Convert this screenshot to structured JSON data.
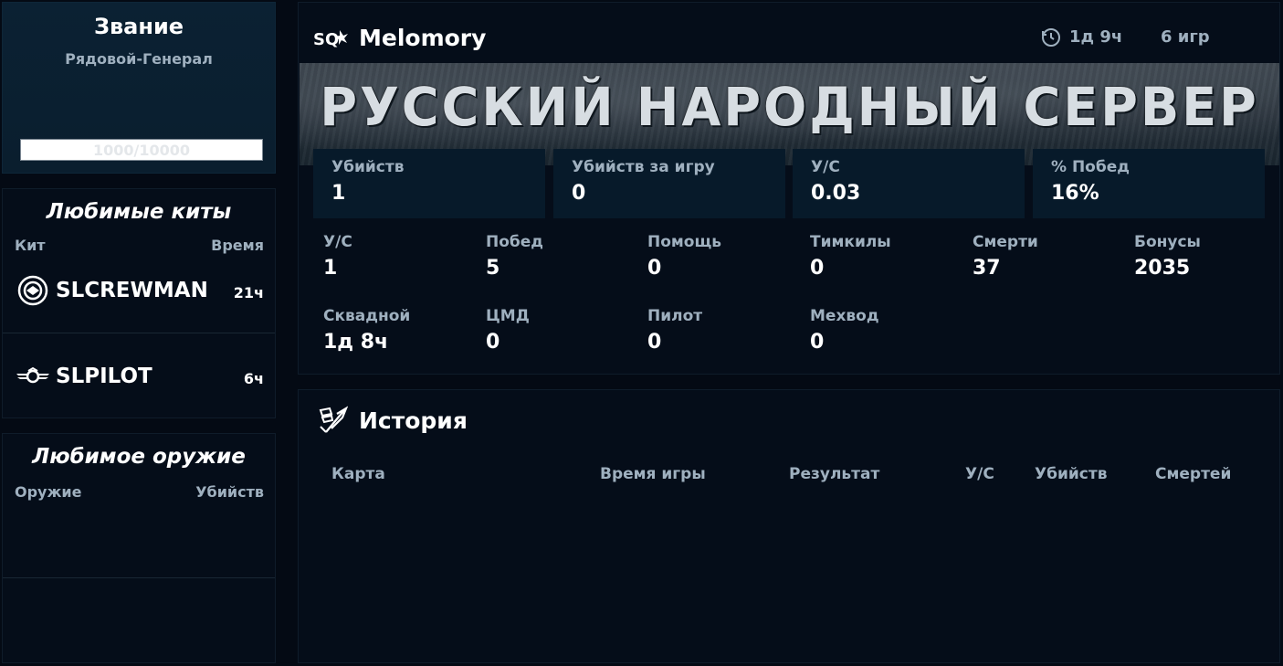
{
  "rank": {
    "title": "Звание",
    "subtitle": "Рядовой-Генерал",
    "progress_text": "1000/10000",
    "progress_fraction": 0.1
  },
  "kits": {
    "title": "Любимые киты",
    "col_kit": "Кит",
    "col_time": "Время",
    "items": [
      {
        "name": "SLCREWMAN",
        "time": "21ч",
        "icon": "crewman-icon"
      },
      {
        "name": "SLPILOT",
        "time": "6ч",
        "icon": "pilot-wings-icon"
      }
    ]
  },
  "weapons": {
    "title": "Любимое оружие",
    "col_weapon": "Оружие",
    "col_kills": "Убийств"
  },
  "profile": {
    "logo": "SQ",
    "name": "Melomory",
    "playtime": "1д 9ч",
    "games": "6 игр",
    "banner": "РУССКИЙ НАРОДНЫЙ СЕРВЕР",
    "cards": [
      {
        "label": "Убийств",
        "value": "1"
      },
      {
        "label": "Убийств за игру",
        "value": "0"
      },
      {
        "label": "У/С",
        "value": "0.03"
      },
      {
        "label": "% Побед",
        "value": "16%"
      }
    ],
    "stats_row1": [
      {
        "label": "У/С",
        "value": "1"
      },
      {
        "label": "Побед",
        "value": "5"
      },
      {
        "label": "Помощь",
        "value": "0"
      },
      {
        "label": "Тимкилы",
        "value": "0"
      },
      {
        "label": "Смерти",
        "value": "37"
      },
      {
        "label": "Бонусы",
        "value": "2035"
      }
    ],
    "stats_row2": [
      {
        "label": "Сквадной",
        "value": "1д 8ч"
      },
      {
        "label": "ЦМД",
        "value": "0"
      },
      {
        "label": "Пилот",
        "value": "0"
      },
      {
        "label": "Мехвод",
        "value": "0"
      }
    ]
  },
  "history": {
    "title": "История",
    "columns": [
      "Карта",
      "Время игры",
      "Результат",
      "У/С",
      "Убийств",
      "Смертей"
    ]
  },
  "colors": {
    "background": "#040a14",
    "panel": "#050d19",
    "card": "#071a2a",
    "label": "#9fb0bf",
    "text": "#ffffff"
  }
}
